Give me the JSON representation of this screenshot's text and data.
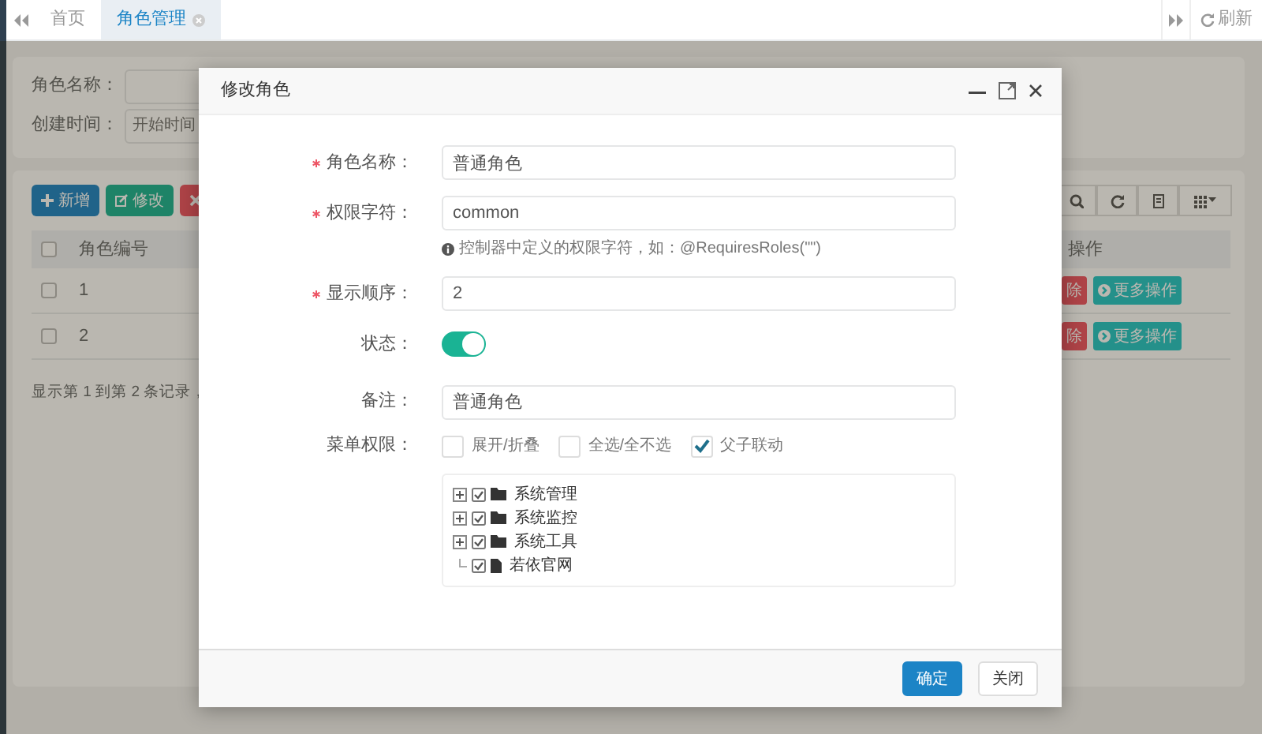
{
  "top_tabs": {
    "items": [
      {
        "label": "首页",
        "selected": false,
        "closable": false
      },
      {
        "label": "角色管理",
        "selected": true,
        "closable": true
      }
    ],
    "refresh_label": "刷新"
  },
  "search_form": {
    "fields": [
      {
        "label": "角色名称："
      },
      {
        "label": "创建时间：",
        "placeholder": "开始时间"
      }
    ]
  },
  "toolbar": {
    "buttons": [
      {
        "kind": "add",
        "label": "新增"
      },
      {
        "kind": "edit",
        "label": "修改"
      },
      {
        "kind": "delete"
      }
    ]
  },
  "table": {
    "header_checked": false,
    "columns": [
      {
        "label": "角色编号"
      },
      {
        "label": "操作"
      }
    ],
    "rows": [
      {
        "checked": false,
        "column_1": "1",
        "actions": [
          "除",
          "更多操作"
        ]
      },
      {
        "checked": false,
        "column_1": "2",
        "actions": [
          "除",
          "更多操作"
        ]
      }
    ],
    "footer": "显示第 1 到第 2 条记录，"
  },
  "dialog": {
    "title": "修改角色",
    "fields": [
      {
        "kind": "text",
        "label": "角色名称：",
        "required": true,
        "value": "普通角色"
      },
      {
        "kind": "text",
        "label": "权限字符：",
        "required": true,
        "value": "common",
        "hint": "控制器中定义的权限字符，如：@RequiresRoles(\"\")"
      },
      {
        "kind": "text",
        "label": "显示顺序：",
        "required": true,
        "value": "2"
      },
      {
        "kind": "switch",
        "label": "状态：",
        "required": false,
        "on": true
      },
      {
        "kind": "text",
        "label": "备注：",
        "required": false,
        "value": "普通角色"
      },
      {
        "kind": "tree",
        "label": "菜单权限：",
        "required": false,
        "options": [
          {
            "label": "展开/折叠",
            "checked": false
          },
          {
            "label": "全选/全不选",
            "checked": false
          },
          {
            "label": "父子联动",
            "checked": true
          }
        ],
        "nodes": [
          {
            "kind": "folder",
            "label": "系统管理",
            "checked": true,
            "expanded": false
          },
          {
            "kind": "folder",
            "label": "系统监控",
            "checked": true,
            "expanded": false
          },
          {
            "kind": "folder",
            "label": "系统工具",
            "checked": true,
            "expanded": false
          },
          {
            "kind": "page",
            "label": "若依官网",
            "checked": true
          }
        ]
      }
    ],
    "buttons": [
      {
        "kind": "primary",
        "label": "确定"
      },
      {
        "kind": "default",
        "label": "关闭"
      }
    ]
  }
}
